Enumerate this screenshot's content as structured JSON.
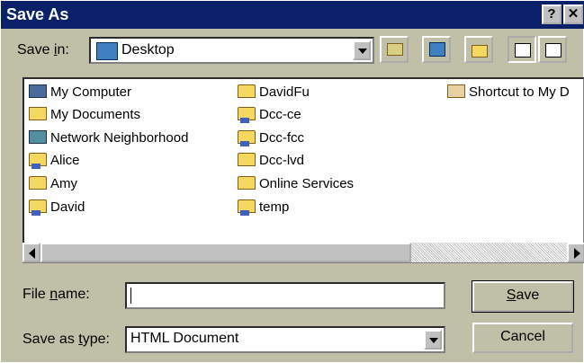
{
  "window": {
    "title": "Save As",
    "help_label": "?",
    "close_label": "✕"
  },
  "save_in": {
    "label_prefix": "Save ",
    "label_u": "i",
    "label_suffix": "n:",
    "value": "Desktop"
  },
  "files": [
    {
      "label": "My Computer",
      "icon": "computer-icon"
    },
    {
      "label": "My Documents",
      "icon": "my-documents-icon"
    },
    {
      "label": "Network Neighborhood",
      "icon": "network-neighborhood-icon"
    },
    {
      "label": "Alice",
      "icon": "shared-folder-icon"
    },
    {
      "label": "Amy",
      "icon": "folder-icon"
    },
    {
      "label": "David",
      "icon": "shared-folder-icon"
    },
    {
      "label": "DavidFu",
      "icon": "folder-icon"
    },
    {
      "label": "Dcc-ce",
      "icon": "shared-folder-icon"
    },
    {
      "label": "Dcc-fcc",
      "icon": "shared-folder-icon"
    },
    {
      "label": "Dcc-lvd",
      "icon": "folder-icon"
    },
    {
      "label": "Online Services",
      "icon": "folder-icon"
    },
    {
      "label": "temp",
      "icon": "shared-folder-icon"
    },
    {
      "label": "Shortcut to My D",
      "icon": "shortcut-icon"
    }
  ],
  "file_name": {
    "label_prefix": "File ",
    "label_u": "n",
    "label_suffix": "ame:",
    "value": ""
  },
  "save_as_type": {
    "label_prefix": "Save as ",
    "label_u": "t",
    "label_suffix": "ype:",
    "value": "HTML Document"
  },
  "buttons": {
    "save_u": "S",
    "save_rest": "ave",
    "cancel": "Cancel"
  }
}
